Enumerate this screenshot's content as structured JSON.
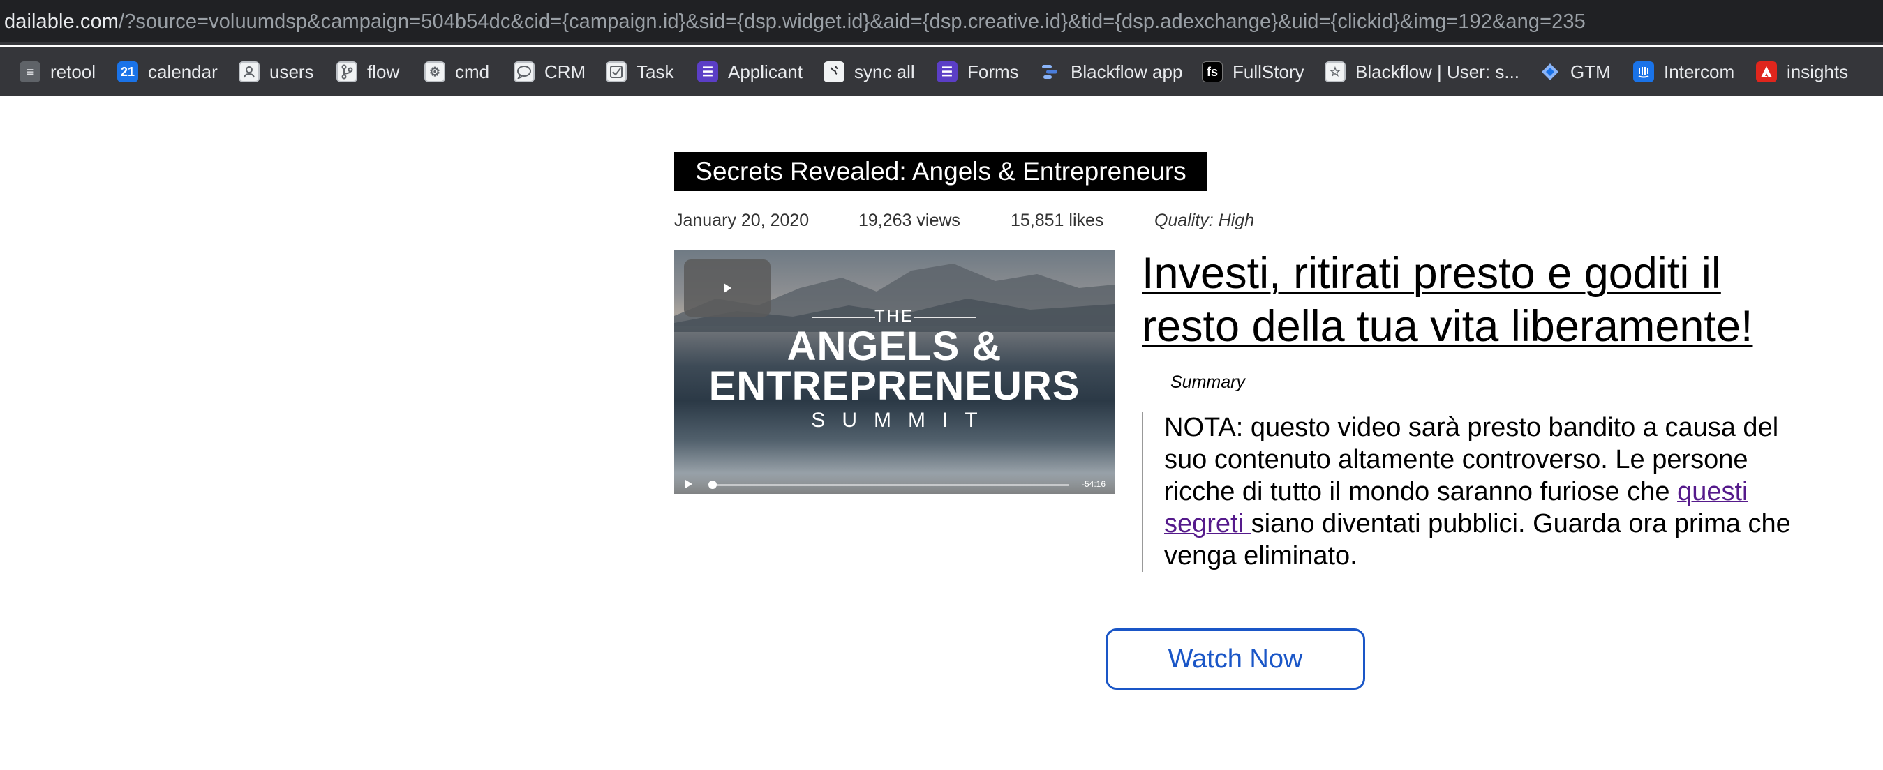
{
  "browser": {
    "url_host": "dailable.com",
    "url_path": "/?source=voluumdsp&campaign=504b54dc&cid={campaign.id}&sid={dsp.widget.id}&aid={dsp.creative.id}&tid={dsp.adexchange}&uid={clickid}&img=192&ang=235"
  },
  "bookmarks": [
    {
      "label": "retool",
      "icon": "retool-icon"
    },
    {
      "label": "calendar",
      "icon": "calendar-icon",
      "icon_text": "21"
    },
    {
      "label": "users",
      "icon": "users-icon"
    },
    {
      "label": "flow",
      "icon": "flow-icon"
    },
    {
      "label": "cmd",
      "icon": "cmd-icon"
    },
    {
      "label": "CRM",
      "icon": "crm-icon"
    },
    {
      "label": "Task",
      "icon": "task-icon"
    },
    {
      "label": "Applicant",
      "icon": "applicant-icon"
    },
    {
      "label": "sync all",
      "icon": "globe-icon"
    },
    {
      "label": "Forms",
      "icon": "forms-icon"
    },
    {
      "label": "Blackflow app",
      "icon": "blackflow-icon"
    },
    {
      "label": "FullStory",
      "icon": "fullstory-icon",
      "icon_text": "fs"
    },
    {
      "label": "Blackflow | User: s...",
      "icon": "star-icon"
    },
    {
      "label": "GTM",
      "icon": "gtm-icon"
    },
    {
      "label": "Intercom",
      "icon": "intercom-icon"
    },
    {
      "label": "insights",
      "icon": "adobe-icon"
    }
  ],
  "article": {
    "title": "Secrets Revealed: Angels & Entrepreneurs",
    "date": "January 20, 2020",
    "views": "19,263 views",
    "likes": "15,851 likes",
    "quality": "Quality: High",
    "headline": "Investi, ritirati presto e goditi il resto della tua vita liberamente!",
    "summary_label": "Summary",
    "summary_before": "NOTA: questo video sarà presto bandito a causa del suo contenuto altamente controverso. Le persone ricche di tutto il mondo saranno furiose che ",
    "summary_link": "questi segreti ",
    "summary_after": "siano diventati pubblici. Guarda ora prima che venga eliminato.",
    "cta_label": "Watch Now"
  },
  "video": {
    "line1": "THE",
    "line2": "ANGELS &",
    "line3": "ENTREPRENEURS",
    "line4": "SUMMIT",
    "duration": "-54:16"
  }
}
